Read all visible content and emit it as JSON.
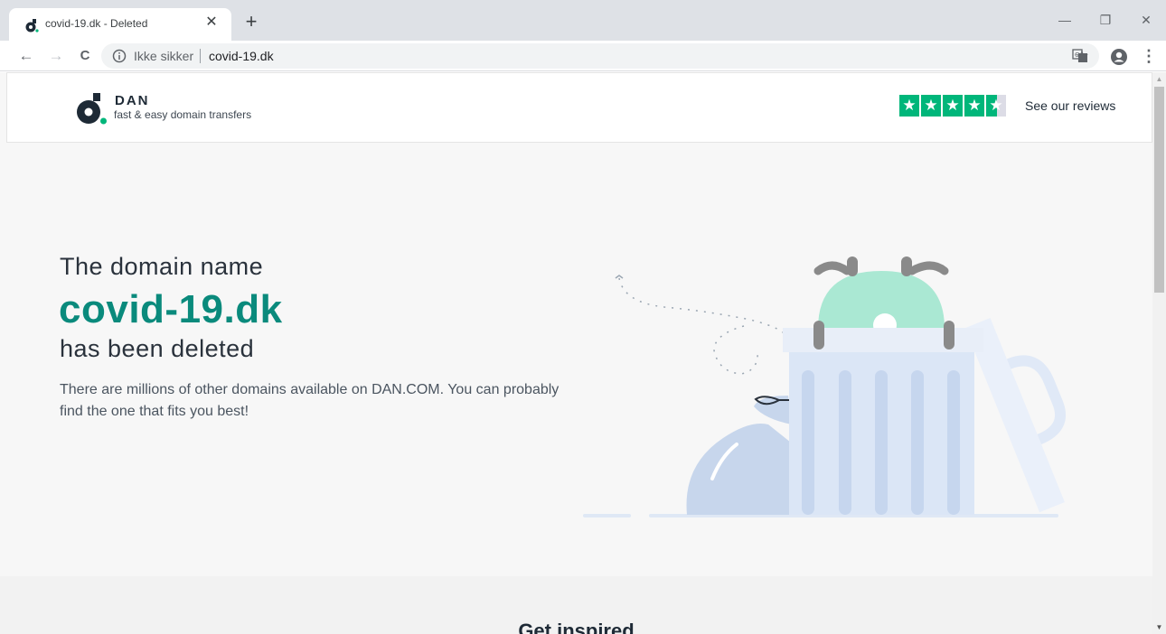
{
  "browser": {
    "tab": {
      "title": "covid-19.dk - Deleted",
      "close_glyph": "✕"
    },
    "new_tab_glyph": "+",
    "window": {
      "minimize": "—",
      "restore": "❐",
      "close": "✕"
    },
    "nav": {
      "back": "←",
      "forward": "→",
      "reload": "C"
    },
    "omnibox": {
      "security_label": "Ikke sikker",
      "url": "covid-19.dk"
    },
    "toolbar": {
      "star_glyph": "☆",
      "menu_glyph": "⋮"
    }
  },
  "header": {
    "brand_name": "DAN",
    "tagline": "fast & easy domain transfers",
    "rating_stars": 4.5,
    "star_glyph": "★",
    "reviews_link": "See our reviews",
    "accent": "#00b67a"
  },
  "hero": {
    "line1": "The domain name",
    "domain": "covid-19.dk",
    "line3": "has been deleted",
    "description": "There are millions of other domains available on DAN.COM. You can probably find the one that fits you best!",
    "accent": "#0a8a7c"
  },
  "section": {
    "title": "Get inspired"
  },
  "scrollbar": {
    "up_glyph": "▲",
    "down_glyph": "▼"
  },
  "icons": [
    "dan-favicon-icon",
    "info-icon",
    "translate-icon",
    "bookmark-star-icon",
    "account-icon",
    "menu-icon",
    "dan-logo-icon",
    "trustpilot-star-icon",
    "trash-can-illustration"
  ]
}
